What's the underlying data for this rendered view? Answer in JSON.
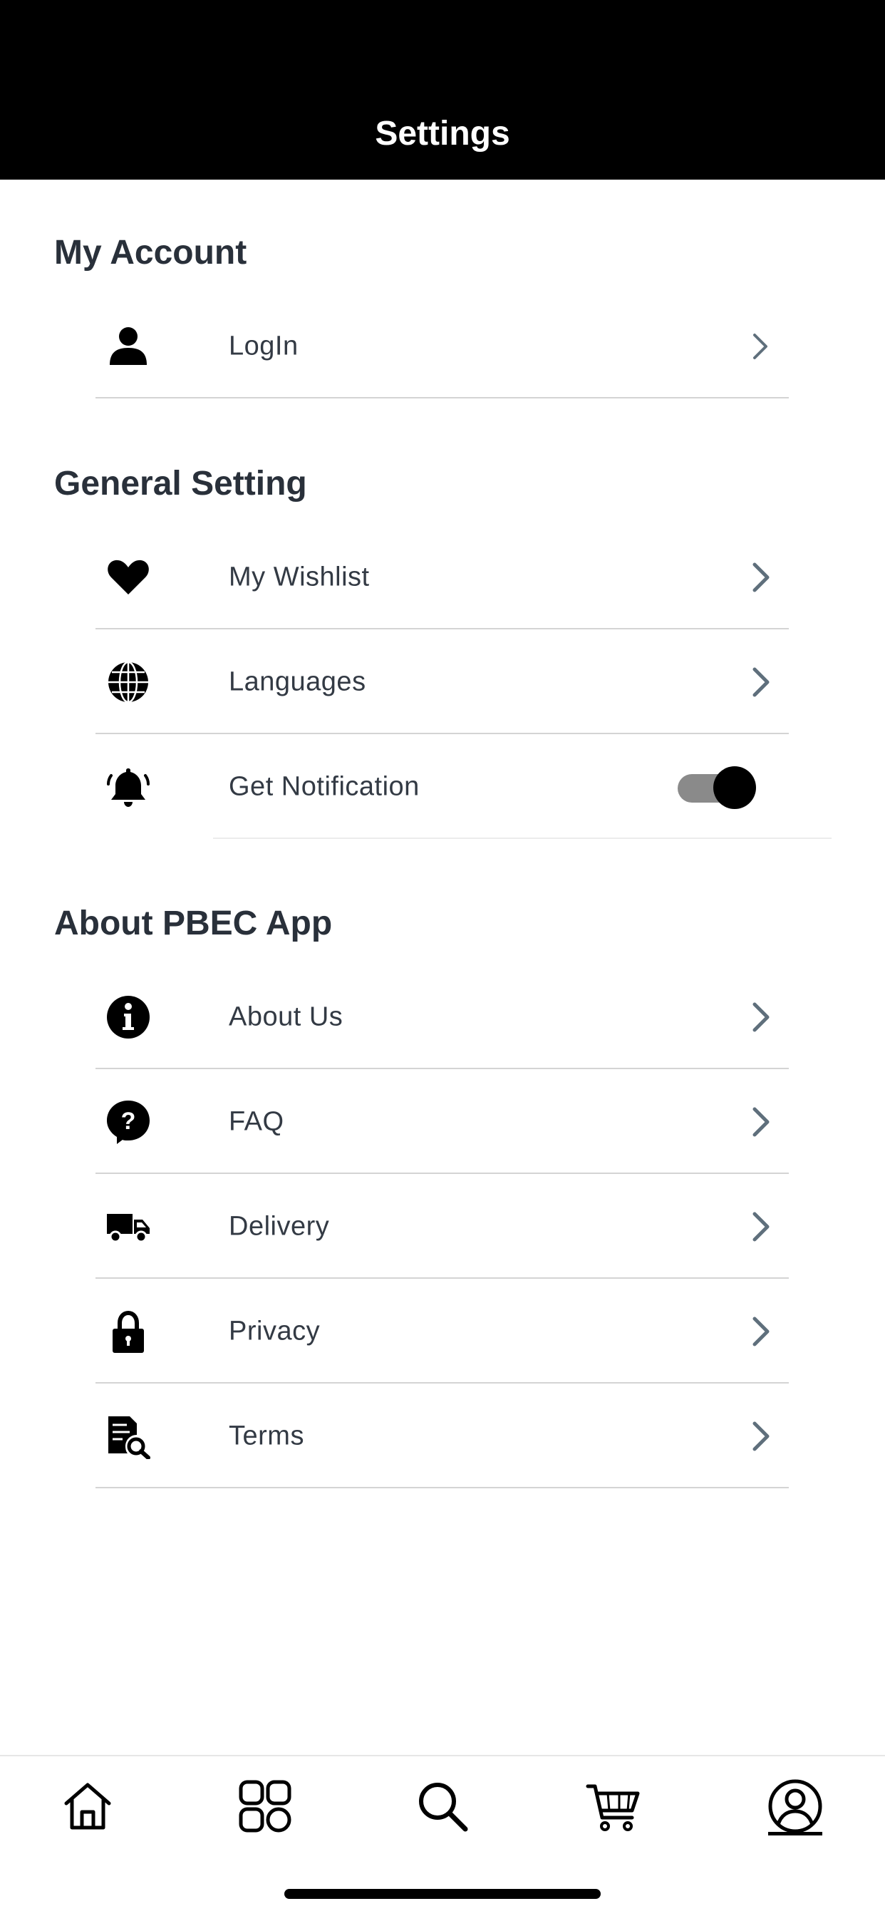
{
  "header": {
    "title": "Settings"
  },
  "sections": {
    "account": {
      "title": "My Account",
      "items": [
        {
          "label": "LogIn",
          "icon": "user-icon"
        }
      ]
    },
    "general": {
      "title": "General Setting",
      "items": [
        {
          "label": "My Wishlist",
          "icon": "heart-icon"
        },
        {
          "label": "Languages",
          "icon": "globe-icon"
        },
        {
          "label": "Get Notification",
          "icon": "bell-icon",
          "toggle_on": true
        }
      ]
    },
    "about": {
      "title": "About PBEC App",
      "items": [
        {
          "label": "About Us",
          "icon": "info-icon"
        },
        {
          "label": "FAQ",
          "icon": "question-bubble-icon"
        },
        {
          "label": "Delivery",
          "icon": "truck-icon"
        },
        {
          "label": "Privacy",
          "icon": "lock-icon"
        },
        {
          "label": "Terms",
          "icon": "document-search-icon"
        }
      ]
    }
  },
  "tabbar": {
    "tabs": [
      {
        "name": "home",
        "icon": "home-icon"
      },
      {
        "name": "categories",
        "icon": "grid-icon"
      },
      {
        "name": "search",
        "icon": "search-icon"
      },
      {
        "name": "cart",
        "icon": "cart-icon"
      },
      {
        "name": "profile",
        "icon": "profile-icon",
        "active": true
      }
    ]
  },
  "colors": {
    "header_bg": "#000000",
    "text": "#29303a",
    "chevron": "#5f6f7c",
    "divider": "#d4d4d4",
    "toggle_track": "#8a8a8a"
  }
}
